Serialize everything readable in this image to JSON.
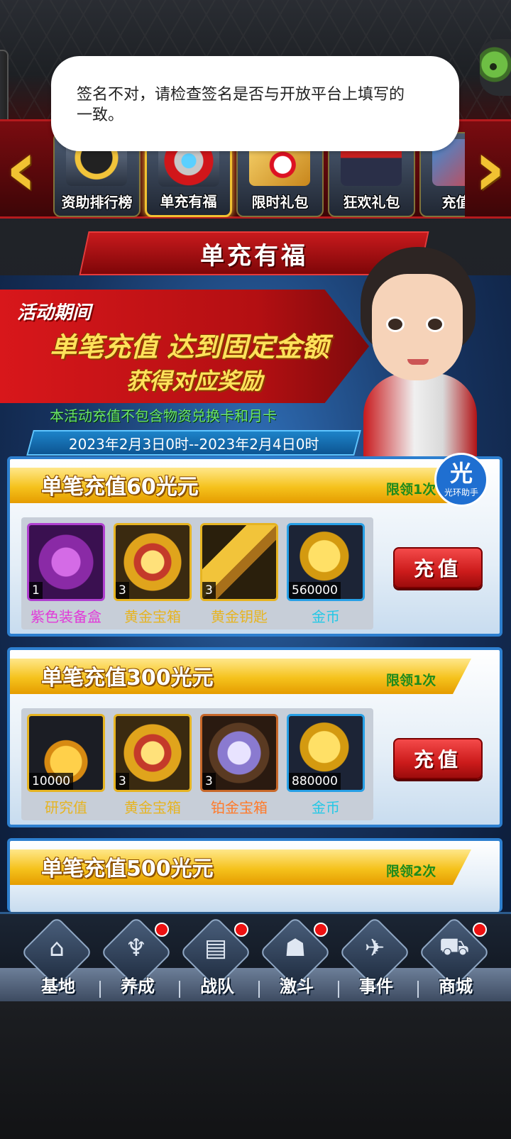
{
  "toast": {
    "text": "签名不对，请检查签名是否与开放平台上填写的一致。"
  },
  "categories": [
    {
      "label": "资助排行榜",
      "active": false
    },
    {
      "label": "单充有福",
      "active": true
    },
    {
      "label": "限时礼包",
      "active": false
    },
    {
      "label": "狂欢礼包",
      "active": false
    },
    {
      "label": "充值返",
      "active": false
    }
  ],
  "title": "单充有福",
  "event": {
    "header": "活动期间",
    "line1": "单笔充值 达到固定金额",
    "line2": "获得对应奖励",
    "note": "本活动充值不包含物资兑换卡和月卡",
    "date_range": "2023年2月3日0时--2023年2月4日0时"
  },
  "helper_badge": {
    "glyph": "光",
    "label": "光环助手"
  },
  "tiers": [
    {
      "title": "单笔充值60光元",
      "limit": "限领1次",
      "button": "充值",
      "items": [
        {
          "name": "紫色装备盒",
          "qty": "1",
          "name_color": "#e13ad8",
          "icon": "purple-box-icon"
        },
        {
          "name": "黄金宝箱",
          "qty": "3",
          "name_color": "#e6b422",
          "icon": "gold-chest-icon"
        },
        {
          "name": "黄金钥匙",
          "qty": "3",
          "name_color": "#e6b422",
          "icon": "gold-key-icon"
        },
        {
          "name": "金币",
          "qty": "560000",
          "name_color": "#23c8e6",
          "icon": "gold-coin-icon"
        }
      ]
    },
    {
      "title": "单笔充值300光元",
      "limit": "限领1次",
      "button": "充值",
      "items": [
        {
          "name": "研究值",
          "qty": "10000",
          "name_color": "#e6b422",
          "icon": "flask-icon"
        },
        {
          "name": "黄金宝箱",
          "qty": "3",
          "name_color": "#e6b422",
          "icon": "gold-chest-icon"
        },
        {
          "name": "铂金宝箱",
          "qty": "3",
          "name_color": "#ff7a2a",
          "icon": "platinum-chest-icon"
        },
        {
          "name": "金币",
          "qty": "880000",
          "name_color": "#23c8e6",
          "icon": "gold-coin-icon"
        }
      ]
    },
    {
      "title": "单笔充值500光元",
      "limit": "限领2次"
    }
  ],
  "nav": [
    {
      "label": "基地",
      "icon": "base-icon",
      "dot": false,
      "glyph": "⌂"
    },
    {
      "label": "养成",
      "icon": "trophy-icon",
      "dot": true,
      "glyph": "♆"
    },
    {
      "label": "战队",
      "icon": "cards-icon",
      "dot": true,
      "glyph": "▤"
    },
    {
      "label": "激斗",
      "icon": "hero-helmet-icon",
      "dot": true,
      "glyph": "☗"
    },
    {
      "label": "事件",
      "icon": "jet-icon",
      "dot": false,
      "glyph": "✈"
    },
    {
      "label": "商城",
      "icon": "cart-icon",
      "dot": true,
      "glyph": "⛟"
    }
  ]
}
